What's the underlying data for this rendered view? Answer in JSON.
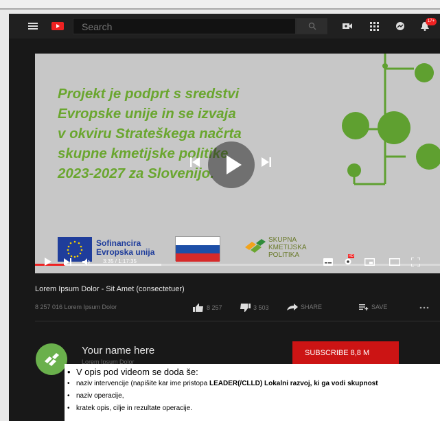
{
  "header": {
    "search_placeholder": "Search",
    "notification_count": "17+"
  },
  "player": {
    "slide_lines": [
      "Projekt je podprt s sredstvi",
      "Evropske unije in se izvaja",
      "v okviru Strateškega načrta",
      "skupne kmetijske politike",
      "2023-2027 za Slovenijo."
    ],
    "eu_label_line1": "Sofinancira",
    "eu_label_line2": "Evropska unija",
    "skp_line1": "SKUPNA",
    "skp_line2": "KMETIJSKA",
    "skp_line3": "POLITIKA",
    "time": "3:35 / 1:17:35",
    "hd_badge": "HD",
    "progress": 0.075
  },
  "video": {
    "title": "Lorem Ipsum Dolor - Sit Amet (consectetuer)",
    "views": "8 257 016 Lorem Ipsum Dolor",
    "likes": "8 257",
    "dislikes": "3 503",
    "share": "SHARE",
    "save": "SAVE"
  },
  "channel": {
    "name": "Your name here",
    "sub": "Lorem Ipsum Dolor",
    "subscribe": "SUBSCRIBE  8,8 M"
  },
  "notes": {
    "heading": "V opis pod videom se doda še:",
    "line1_prefix": "naziv intervencije (napišite kar ime pristopa ",
    "line1_bold": "LEADER(/CLLD) Lokalni razvoj, ki ga vodi skupnost",
    "line2": "naziv operacije,",
    "line3": "kratek opis, cilje in rezultate operacije."
  },
  "colors": {
    "accent_red": "#cc1414",
    "slide_green": "#6aa62f",
    "tree_green": "#5fa030"
  }
}
